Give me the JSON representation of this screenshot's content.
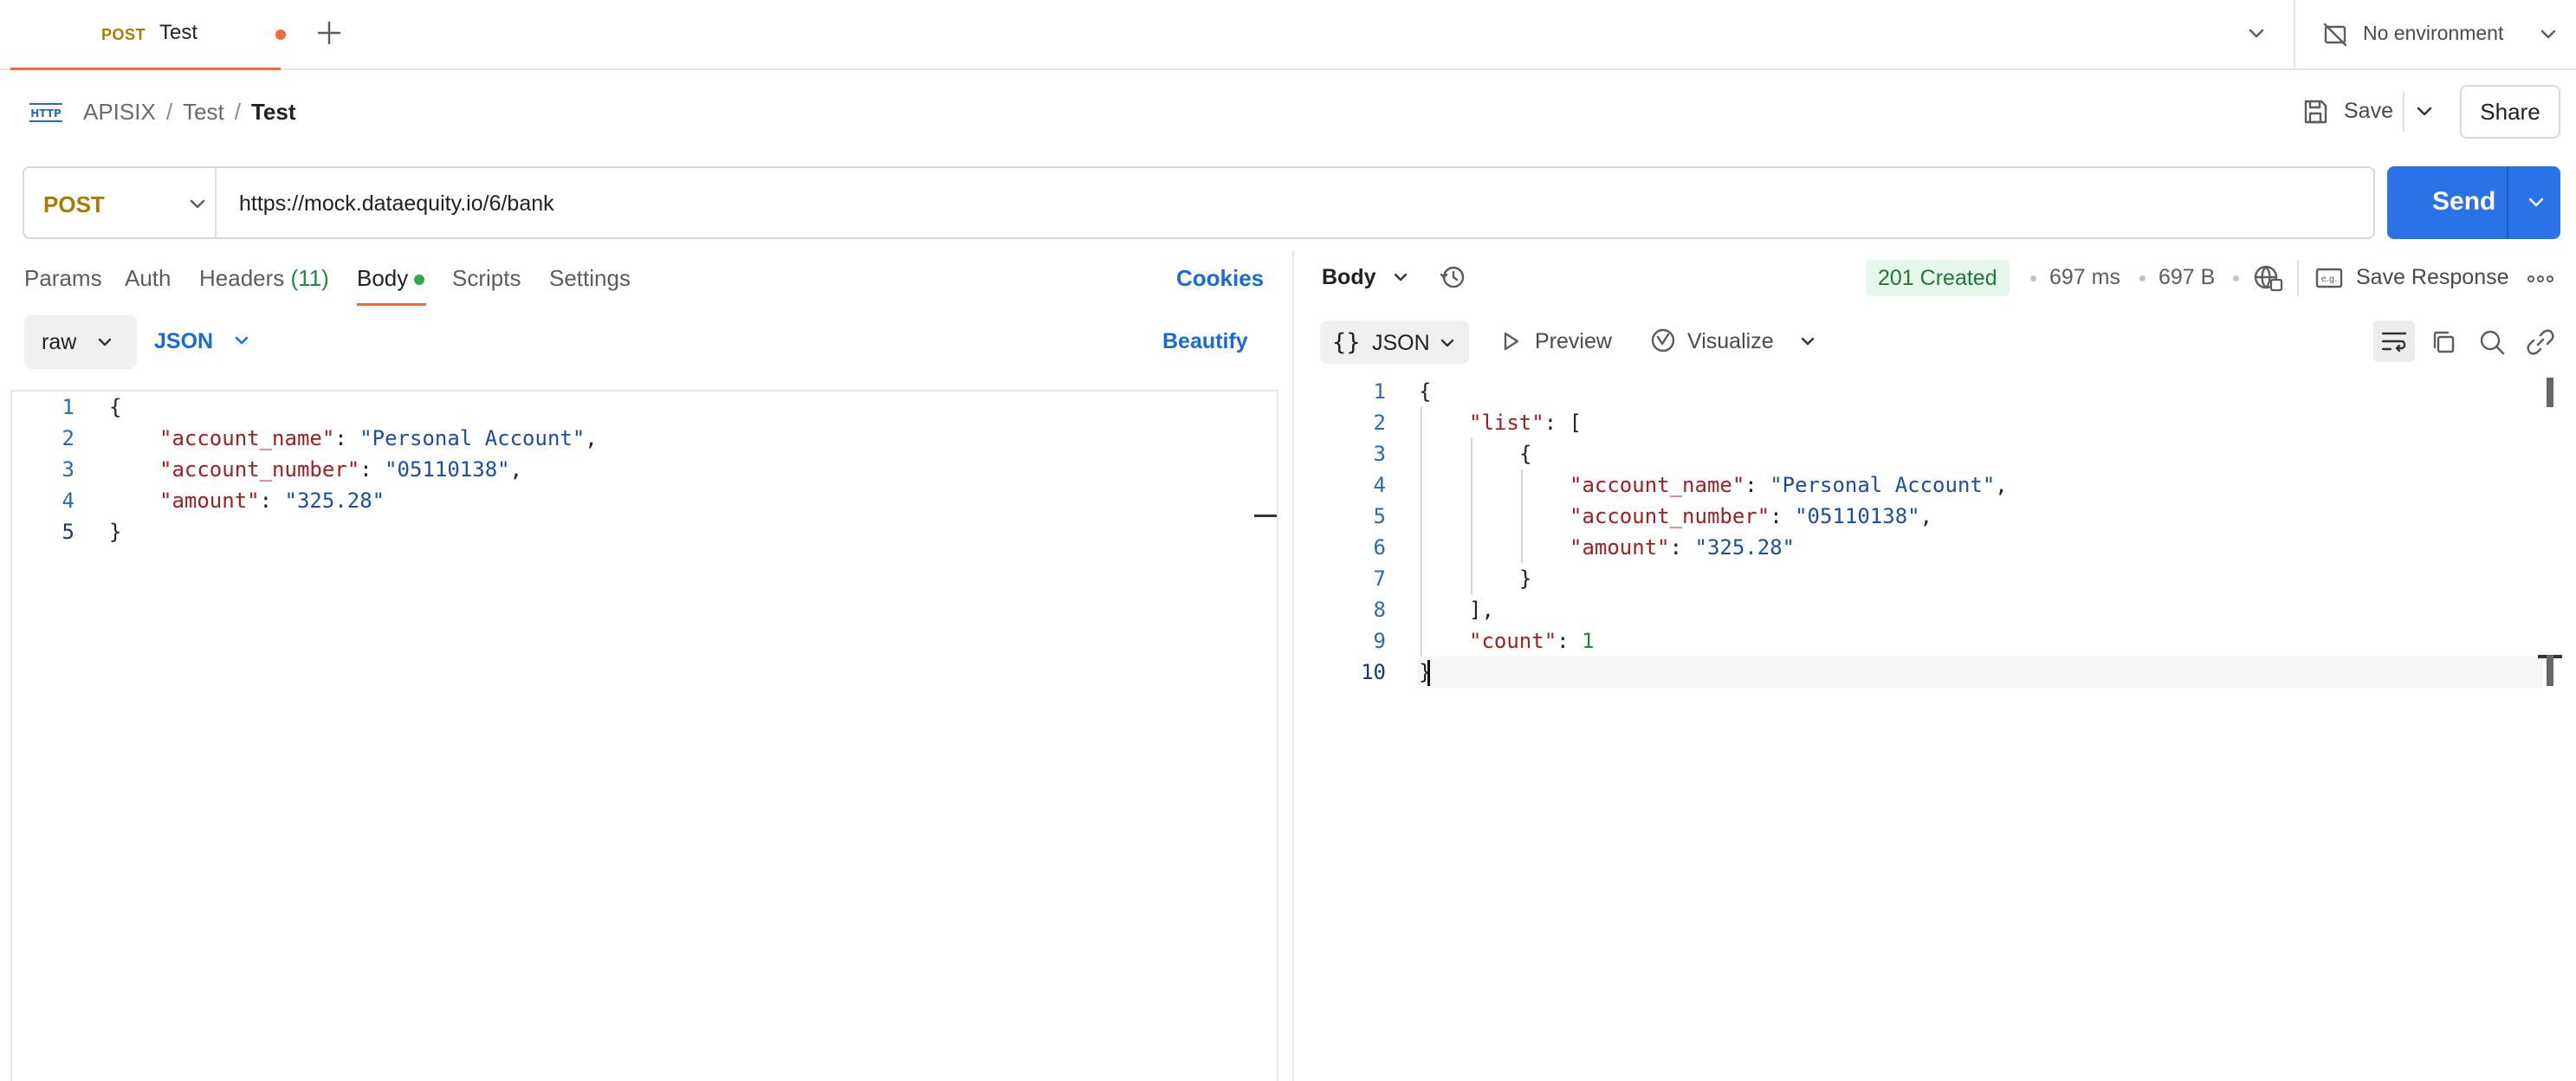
{
  "tabs": [
    {
      "method": "POST",
      "name": "Test",
      "unsaved": true
    }
  ],
  "environment": {
    "label": "No environment"
  },
  "breadcrumb": {
    "items": [
      "APISIX",
      "Test"
    ],
    "current": "Test"
  },
  "actions": {
    "save_label": "Save",
    "share_label": "Share"
  },
  "request": {
    "method": "POST",
    "url": "https://mock.dataequity.io/6/bank",
    "send_label": "Send",
    "tabs": [
      {
        "label": "Params"
      },
      {
        "label": "Auth"
      },
      {
        "label": "Headers",
        "count": "(11)"
      },
      {
        "label": "Body",
        "active": true
      },
      {
        "label": "Scripts"
      },
      {
        "label": "Settings"
      }
    ],
    "cookies_label": "Cookies",
    "body_mode": "raw",
    "body_language": "JSON",
    "beautify_label": "Beautify",
    "body_lines": [
      {
        "n": "1",
        "text": "{"
      },
      {
        "n": "2",
        "key": "\"account_name\"",
        "value": "\"Personal Account\"",
        "end": ","
      },
      {
        "n": "3",
        "key": "\"account_number\"",
        "value": "\"05110138\"",
        "end": ","
      },
      {
        "n": "4",
        "key": "\"amount\"",
        "value": "\"325.28\"",
        "end": ""
      },
      {
        "n": "5",
        "text": "}"
      }
    ]
  },
  "response": {
    "view_label": "Body",
    "status": "201 Created",
    "time": "697 ms",
    "size": "697 B",
    "save_response_label": "Save Response",
    "format": {
      "braces": "{}",
      "label": "JSON"
    },
    "preview_label": "Preview",
    "visualize_label": "Visualize",
    "lines": [
      {
        "n": "1",
        "indent": 0,
        "parts": [
          {
            "t": "p",
            "v": "{"
          }
        ]
      },
      {
        "n": "2",
        "indent": 1,
        "parts": [
          {
            "t": "k",
            "v": "\"list\""
          },
          {
            "t": "p",
            "v": ": ["
          }
        ]
      },
      {
        "n": "3",
        "indent": 2,
        "parts": [
          {
            "t": "p",
            "v": "{"
          }
        ]
      },
      {
        "n": "4",
        "indent": 3,
        "parts": [
          {
            "t": "k",
            "v": "\"account_name\""
          },
          {
            "t": "p",
            "v": ": "
          },
          {
            "t": "s",
            "v": "\"Personal Account\""
          },
          {
            "t": "p",
            "v": ","
          }
        ]
      },
      {
        "n": "5",
        "indent": 3,
        "parts": [
          {
            "t": "k",
            "v": "\"account_number\""
          },
          {
            "t": "p",
            "v": ": "
          },
          {
            "t": "s",
            "v": "\"05110138\""
          },
          {
            "t": "p",
            "v": ","
          }
        ]
      },
      {
        "n": "6",
        "indent": 3,
        "parts": [
          {
            "t": "k",
            "v": "\"amount\""
          },
          {
            "t": "p",
            "v": ": "
          },
          {
            "t": "s",
            "v": "\"325.28\""
          }
        ]
      },
      {
        "n": "7",
        "indent": 2,
        "parts": [
          {
            "t": "p",
            "v": "}"
          }
        ]
      },
      {
        "n": "8",
        "indent": 1,
        "parts": [
          {
            "t": "p",
            "v": "],"
          }
        ]
      },
      {
        "n": "9",
        "indent": 1,
        "parts": [
          {
            "t": "k",
            "v": "\"count\""
          },
          {
            "t": "p",
            "v": ": "
          },
          {
            "t": "n",
            "v": "1"
          }
        ]
      },
      {
        "n": "10",
        "indent": 0,
        "parts": [
          {
            "t": "p",
            "v": "}"
          }
        ]
      }
    ]
  },
  "colors": {
    "accent": "#f26b3a",
    "send": "#2a72e5",
    "link": "#1a6ad6",
    "status_bg": "#e6f6ea",
    "status_fg": "#1f7a34"
  }
}
